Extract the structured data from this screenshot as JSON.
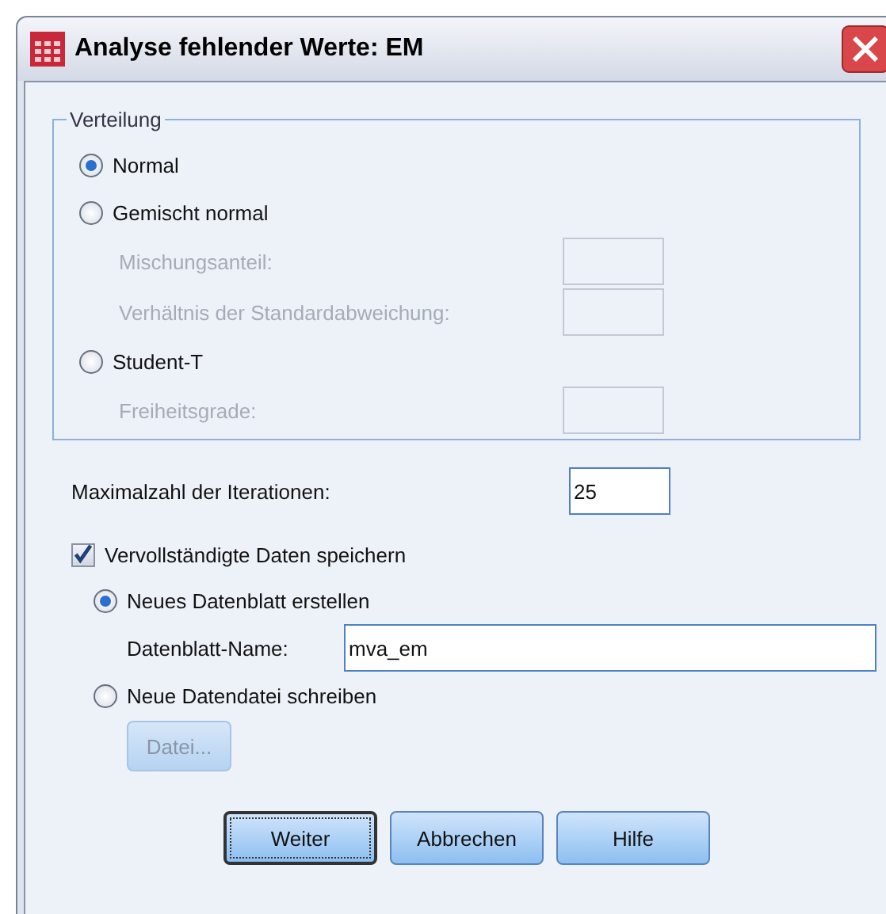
{
  "window": {
    "title": "Analyse fehlender Werte: EM"
  },
  "distribution": {
    "legend": "Verteilung",
    "options": [
      {
        "label": "Normal",
        "selected": true
      },
      {
        "label": "Gemischt normal",
        "selected": false,
        "fields": [
          {
            "label": "Mischungsanteil:",
            "disabled": true
          },
          {
            "label": "Verhältnis der Standardabweichung:",
            "disabled": true
          }
        ]
      },
      {
        "label": "Student-T",
        "selected": false,
        "fields": [
          {
            "label": "Freiheitsgrade:",
            "disabled": true
          }
        ]
      }
    ]
  },
  "iterations": {
    "label": "Maximalzahl der Iterationen:",
    "value": "25"
  },
  "save": {
    "label": "Vervollständigte Daten speichern",
    "checked": true,
    "options": [
      {
        "label": "Neues Datenblatt erstellen",
        "selected": true,
        "field": {
          "label": "Datenblatt-Name:",
          "value": "mva_em"
        }
      },
      {
        "label": "Neue Datendatei schreiben",
        "selected": false,
        "button": {
          "label": "Datei...",
          "disabled": true
        }
      }
    ]
  },
  "buttons": [
    {
      "label": "Weiter",
      "focused": true
    },
    {
      "label": "Abbrechen",
      "focused": false
    },
    {
      "label": "Hilfe",
      "focused": false
    }
  ]
}
